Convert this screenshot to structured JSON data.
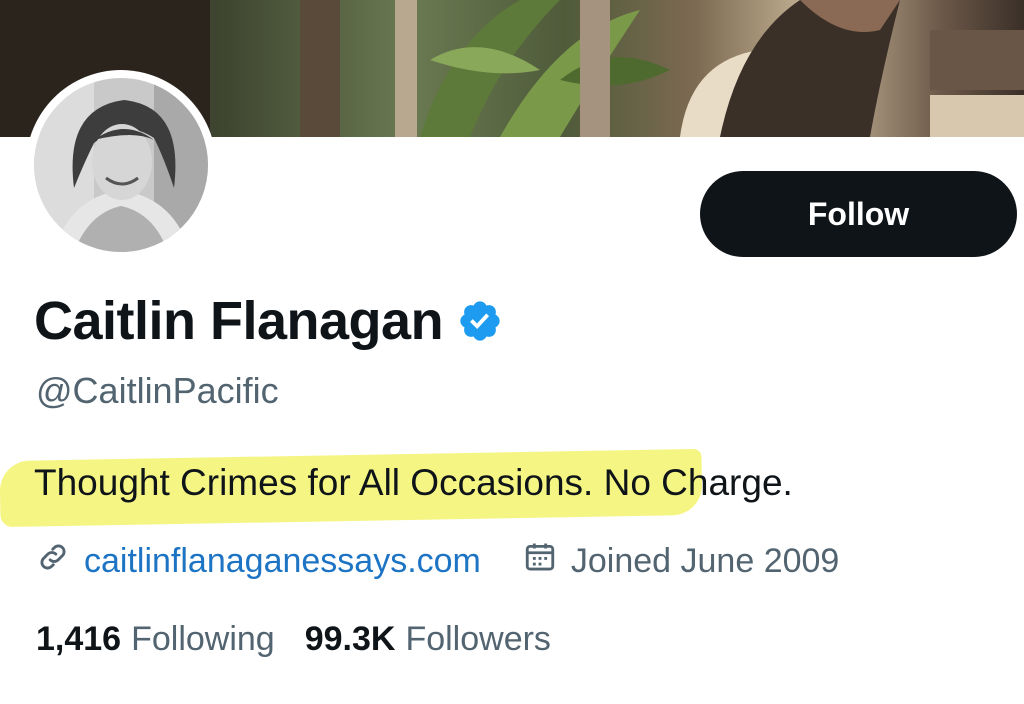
{
  "profile": {
    "display_name": "Caitlin Flanagan",
    "handle": "@CaitlinPacific",
    "bio_highlighted": "Thought Crimes for All Occasions. N",
    "bio_rest": "o Charge.",
    "website": "caitlinflanaganessays.com",
    "joined": "Joined June 2009"
  },
  "actions": {
    "follow_label": "Follow"
  },
  "stats": {
    "following_count": "1,416",
    "following_label": "Following",
    "followers_count": "99.3K",
    "followers_label": "Followers"
  },
  "icons": {
    "verified": "verified-badge-icon",
    "link": "link-icon",
    "calendar": "calendar-icon"
  },
  "colors": {
    "verified_blue": "#1d9bf0",
    "link_blue": "#1d74c4",
    "secondary_text": "#536471",
    "follow_button": "#0f1419",
    "highlight": "#f2f25a"
  }
}
